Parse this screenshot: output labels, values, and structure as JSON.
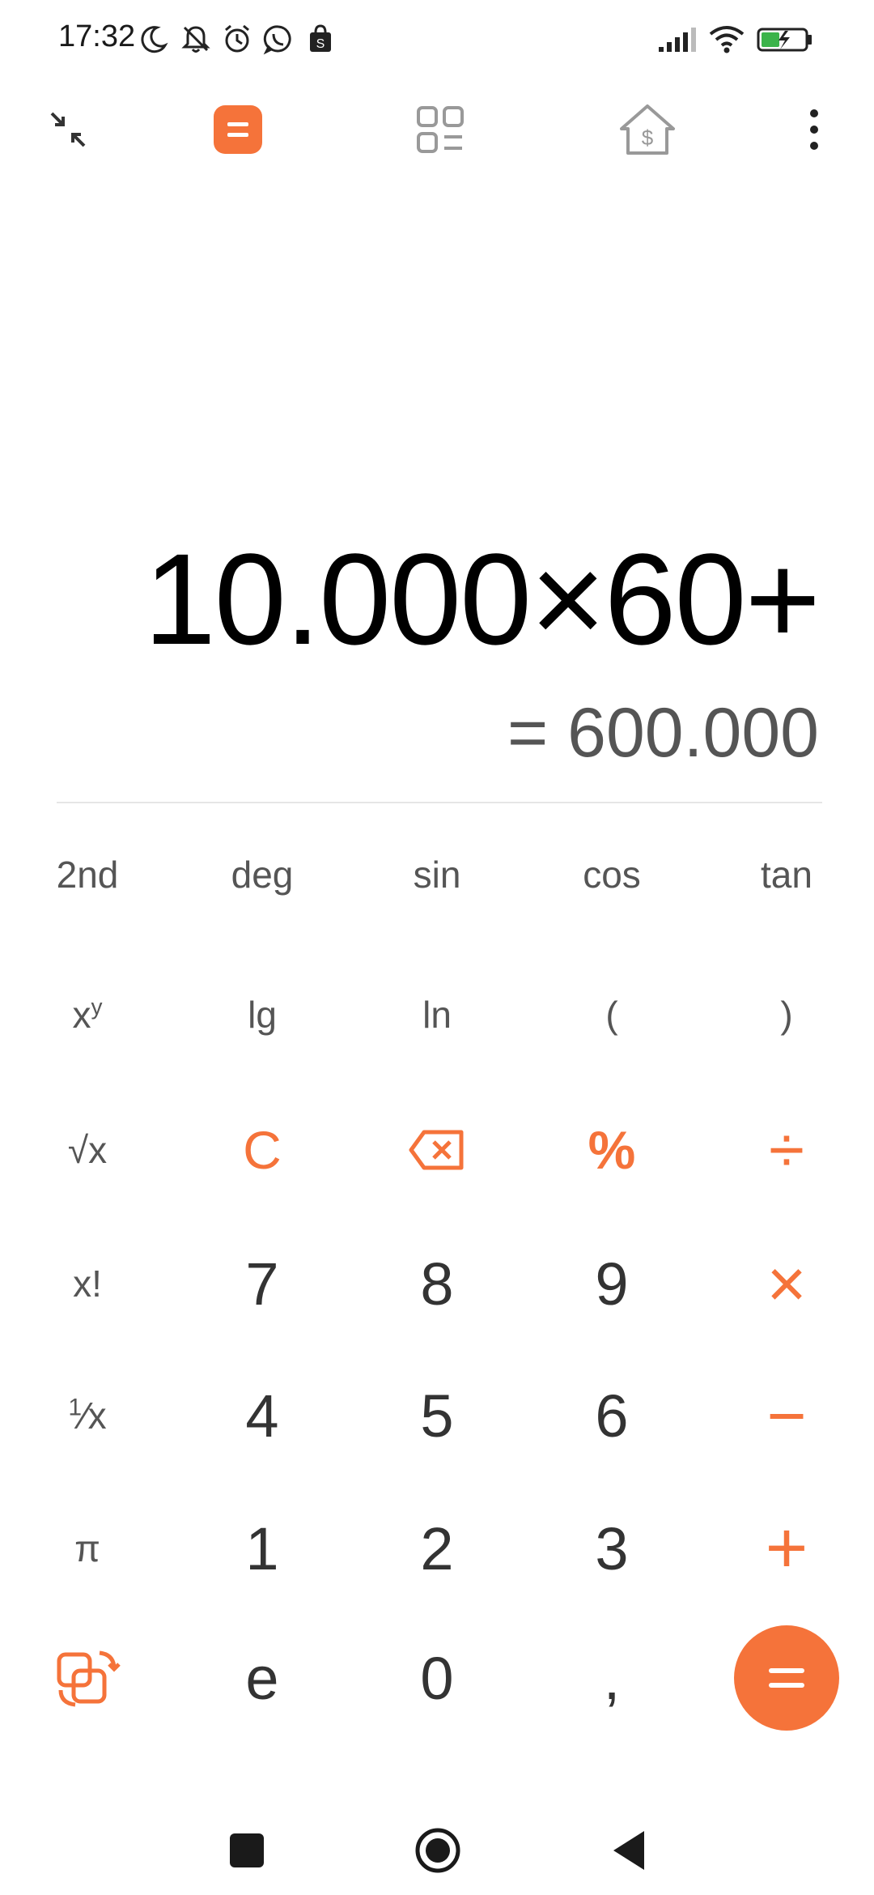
{
  "status_bar": {
    "time": "17:32",
    "icons": [
      "moon-icon",
      "bell-off-icon",
      "alarm-icon",
      "whatsapp-icon",
      "shopping-bag-icon",
      "signal-icon",
      "wifi-icon",
      "battery-charging-icon"
    ]
  },
  "toolbar": {
    "icons": [
      "minimize-icon",
      "calculator-icon",
      "converter-grid-icon",
      "finance-house-icon",
      "more-vert-icon"
    ],
    "active": "calculator-icon"
  },
  "display": {
    "expression": "10.000×60+",
    "result": "= 600.000"
  },
  "keypad": {
    "row1": [
      "2nd",
      "deg",
      "sin",
      "cos",
      "tan"
    ],
    "row2": [
      "lg",
      "ln",
      "(",
      ")"
    ],
    "row3_first": "√x",
    "row4": [
      "x!",
      "7",
      "8",
      "9"
    ],
    "row5": [
      "4",
      "5",
      "6"
    ],
    "row6": [
      "π",
      "1",
      "2",
      "3"
    ],
    "row7": [
      "e",
      "0",
      ","
    ],
    "ops": [
      "C",
      "%",
      "÷",
      "×",
      "−",
      "+",
      "="
    ]
  },
  "colors": {
    "accent": "#f5733a",
    "text_primary": "#000000",
    "text_secondary": "#555555"
  }
}
